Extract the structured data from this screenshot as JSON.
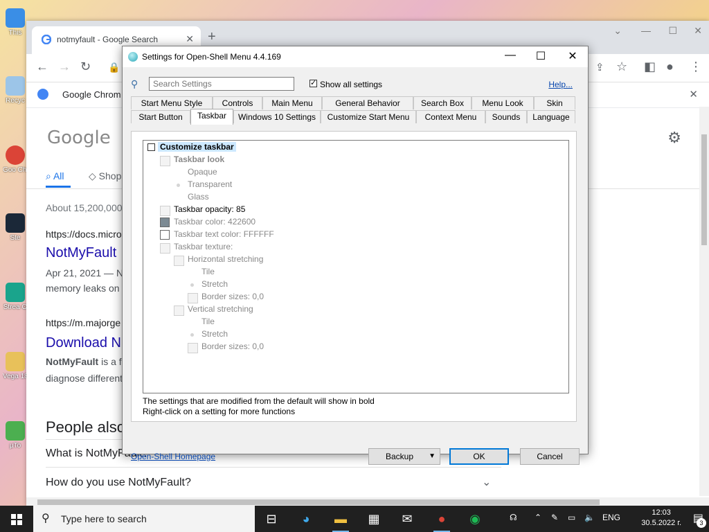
{
  "desktop": {
    "icons": [
      {
        "label": "This",
        "color": "#3a8ee6"
      },
      {
        "label": "Recyc",
        "color": "#9cc5e8"
      },
      {
        "label": "Goo Chr",
        "color": "#db4437"
      },
      {
        "label": "Ste",
        "color": "#1b2838"
      },
      {
        "label": "Strea O",
        "color": "#1aa48c"
      },
      {
        "label": "Vega 18.0 (",
        "color": "#e8c15a"
      },
      {
        "label": "µTo",
        "color": "#4caf50"
      }
    ]
  },
  "chrome": {
    "tab_title": "notmyfault - Google Search",
    "new_tab": "+",
    "bookmark_label": "Google Chrom",
    "logo": "Google",
    "tab_all": "All",
    "tab_shopping": "Shop",
    "results_count": "About 15,200,000",
    "result1_url": "https://docs.micro",
    "result1_title": "NotMyFault",
    "result1_date": "Apr 21, 2021 — N",
    "result1_snip": "memory leaks on",
    "result2_url": "https://m.majorge",
    "result2_title": "Download N",
    "result2_snip_bold": "NotMyFault",
    "result2_snip": " is a fr",
    "result2_snip2": "diagnose different",
    "people_also": "People also",
    "q1": "What is NotMyFault?",
    "q2": "How do you use NotMyFault?"
  },
  "dialog": {
    "title": "Settings for Open-Shell Menu 4.4.169",
    "search_placeholder": "Search Settings",
    "show_all": "Show all settings",
    "help": "Help...",
    "tabs_row1": [
      "Start Menu Style",
      "Controls",
      "Main Menu",
      "General Behavior",
      "Search Box",
      "Menu Look",
      "Skin"
    ],
    "tabs_row2": [
      "Start Button",
      "Taskbar",
      "Windows 10 Settings",
      "Customize Start Menu",
      "Context Menu",
      "Sounds",
      "Language"
    ],
    "active_tab": "Taskbar",
    "tree": {
      "customize": "Customize taskbar",
      "look": "Taskbar look",
      "opaque": "Opaque",
      "transparent": "Transparent",
      "glass": "Glass",
      "opacity": "Taskbar opacity: 85",
      "color": "Taskbar color: 422600",
      "text_color": "Taskbar text color: FFFFFF",
      "texture": "Taskbar texture:",
      "h_stretch": "Horizontal stretching",
      "tile1": "Tile",
      "stretch1": "Stretch",
      "border1": "Border sizes: 0,0",
      "v_stretch": "Vertical stretching",
      "tile2": "Tile",
      "stretch2": "Stretch",
      "border2": "Border sizes: 0,0"
    },
    "note1": "The settings that are modified from the default will show in bold",
    "note2": "Right-click on a setting for more functions",
    "homepage": "Open-Shell Homepage",
    "backup": "Backup",
    "ok": "OK",
    "cancel": "Cancel",
    "swatch_color": "#7c8a93",
    "swatch_text_color": "#ffffff"
  },
  "taskbar": {
    "search_placeholder": "Type here to search",
    "lang": "ENG",
    "time": "12:03",
    "date": "30.5.2022 г.",
    "notifications": "3"
  }
}
